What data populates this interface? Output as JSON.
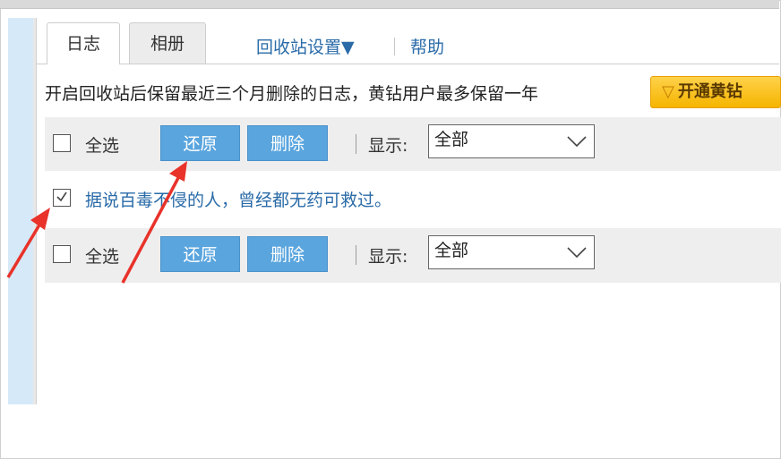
{
  "tabs": [
    {
      "label": "日志",
      "active": true
    },
    {
      "label": "相册",
      "active": false
    }
  ],
  "links": {
    "recycle_settings": "回收站设置▼",
    "help": "帮助"
  },
  "notice": "开启回收站后保留最近三个月删除的日志，黄钻用户最多保留一年",
  "vip_button": {
    "label": "开通黄钻"
  },
  "toolbar_top": {
    "select_all": "全选",
    "restore": "还原",
    "delete": "删除",
    "show_label": "显示:",
    "filter_value": "全部"
  },
  "item": {
    "checked": true,
    "title": "据说百毒不侵的人，曾经都无药可救过。"
  },
  "toolbar_bottom": {
    "select_all": "全选",
    "restore": "还原",
    "delete": "删除",
    "show_label": "显示:",
    "filter_value": "全部"
  },
  "colors": {
    "button_blue": "#5aa5de",
    "link_blue": "#2a6ba8",
    "vip_gold": "#f5b400",
    "annotation_red": "#e8322a"
  },
  "icons": {
    "dropdown": "chevron-down-icon",
    "vip": "diamond-icon",
    "check": "checkmark-icon"
  }
}
